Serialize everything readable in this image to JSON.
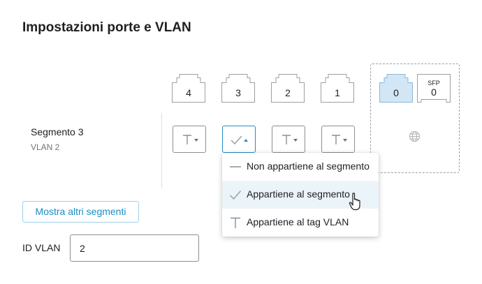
{
  "title": "Impostazioni porte e VLAN",
  "ports": [
    {
      "label": "4",
      "highlighted": false
    },
    {
      "label": "3",
      "highlighted": false
    },
    {
      "label": "2",
      "highlighted": false
    },
    {
      "label": "1",
      "highlighted": false
    },
    {
      "label": "0",
      "highlighted": true
    }
  ],
  "sfp_port": {
    "type_label": "SFP",
    "label": "0"
  },
  "segment": {
    "name": "Segmento 3",
    "vlan": "VLAN 2"
  },
  "port_selectors": [
    {
      "value": "tag-vlan",
      "open": false
    },
    {
      "value": "member",
      "open": true
    },
    {
      "value": "tag-vlan",
      "open": false
    },
    {
      "value": "tag-vlan",
      "open": false
    }
  ],
  "uplink_icon": "globe-icon",
  "dropdown": {
    "items": [
      {
        "label": "Non appartiene al segmento",
        "icon": "dash-icon",
        "hovered": false
      },
      {
        "label": "Appartiene al segmento",
        "icon": "check-icon",
        "hovered": true
      },
      {
        "label": "Appartiene al tag VLAN",
        "icon": "tag-t-icon",
        "hovered": false
      }
    ]
  },
  "more_segments_button": "Mostra altri segmenti",
  "vlan_id": {
    "label": "ID VLAN",
    "value": "2"
  },
  "colors": {
    "accent": "#1a8dc6",
    "highlight_port_fill": "#d2e6f5",
    "hover_row": "#ebf4f9"
  }
}
